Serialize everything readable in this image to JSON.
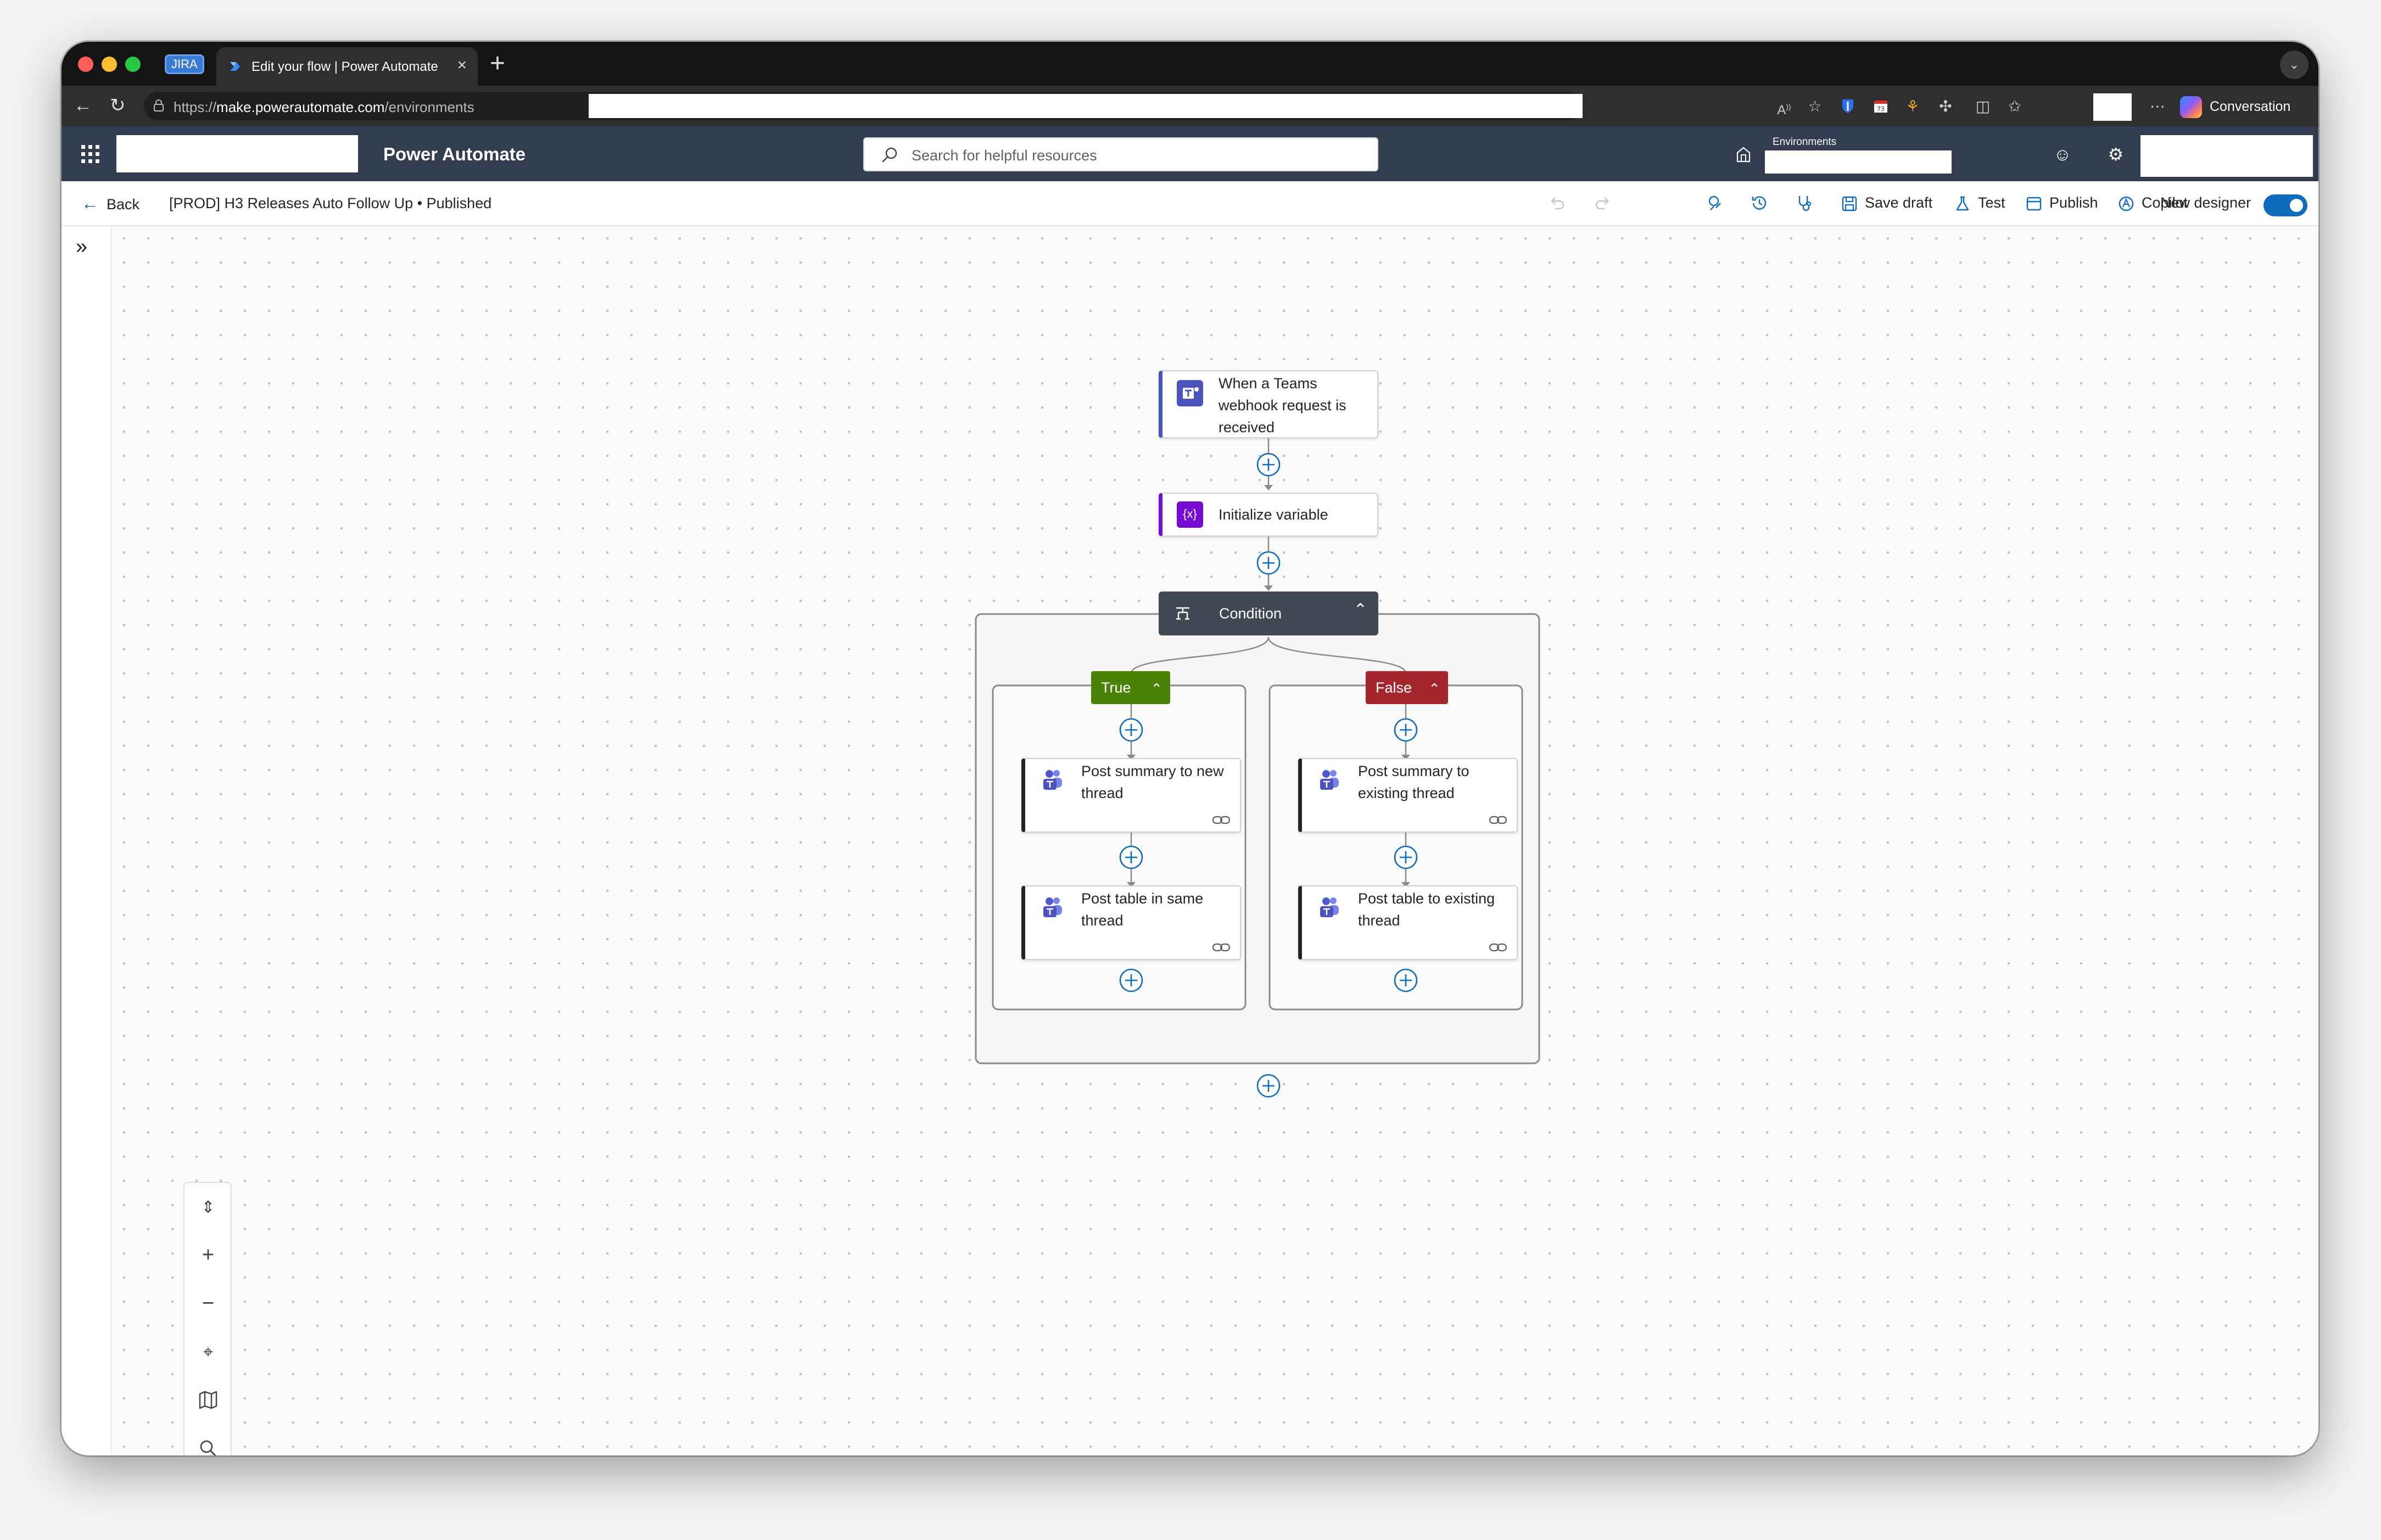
{
  "browser": {
    "pinned_tab_label": "JIRA",
    "active_tab_title": "Edit your flow | Power Automate",
    "url_scheme": "https://",
    "url_host": "make.powerautomate.com",
    "url_path": "/environments",
    "conversation_label": "Conversation"
  },
  "header": {
    "app_name": "Power Automate",
    "search_placeholder": "Search for helpful resources",
    "environments_label": "Environments"
  },
  "commandbar": {
    "back_label": "Back",
    "flow_breadcrumb": "[PROD] H3 Releases Auto Follow Up • Published",
    "save_draft_label": "Save draft",
    "test_label": "Test",
    "publish_label": "Publish",
    "copilot_label": "Copilot",
    "new_designer_label": "New designer",
    "new_designer_enabled": true
  },
  "flow": {
    "trigger": {
      "title": "When a Teams webhook request is received"
    },
    "init_variable": {
      "title": "Initialize variable",
      "icon_text": "{x}"
    },
    "condition": {
      "title": "Condition"
    },
    "true_branch": {
      "label": "True",
      "actions": [
        {
          "title": "Post summary to new thread"
        },
        {
          "title": "Post table in same thread"
        }
      ]
    },
    "false_branch": {
      "label": "False",
      "actions": [
        {
          "title": "Post summary to existing thread"
        },
        {
          "title": "Post table to existing thread"
        }
      ]
    }
  },
  "colors": {
    "header_bg": "#323d4f",
    "accent": "#0f6cbd",
    "true_branch": "#498205",
    "false_branch": "#a4262c",
    "teams_purple": "#4b53bc",
    "variable_purple": "#770bd6",
    "condition_header": "#404854"
  }
}
